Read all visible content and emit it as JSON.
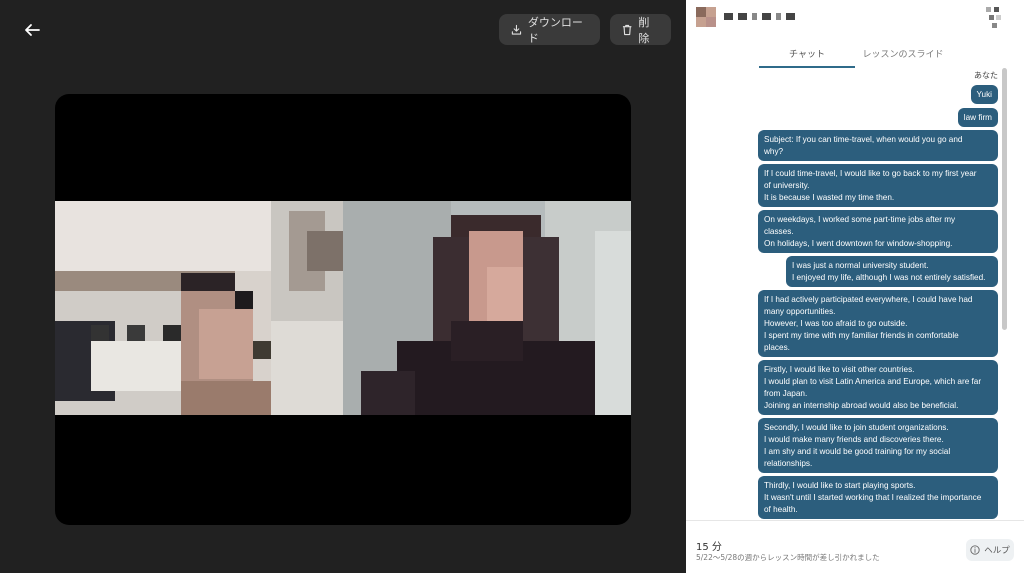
{
  "toolbar": {
    "back_icon": "arrow-left-icon",
    "download_label": "ダウンロード",
    "download_icon": "download-icon",
    "delete_label": "削除",
    "delete_icon": "trash-icon"
  },
  "tabs": [
    {
      "label": "チャット",
      "active": true
    },
    {
      "label": "レッスンのスライド",
      "active": false
    }
  ],
  "chat": {
    "sender_label": "あなた",
    "messages": [
      [
        "Yuki"
      ],
      [
        "law firm"
      ],
      [
        "Subject: If you can time-travel, when would you go and",
        "why?"
      ],
      [
        "If I could time-travel, I would like to go back to my first year",
        "of university.",
        "It is because I wasted my time then."
      ],
      [
        "On weekdays, I worked some part-time jobs after my",
        "classes.",
        "On holidays, I went downtown for window-shopping."
      ],
      [
        "I was just a normal university student.",
        "I enjoyed my life, although I was not entirely satisfied."
      ],
      [
        "If I had actively participated everywhere, I could have had",
        "many opportunities.",
        "However, I was too afraid to go outside.",
        "I spent my time with my familiar friends in comfortable",
        "places."
      ],
      [
        "Firstly, I would like to visit other countries.",
        "I would plan to visit Latin America and Europe, which are far",
        "from Japan.",
        "Joining an internship abroad would also be beneficial."
      ],
      [
        "Secondly, I would like to join student organizations.",
        "I would make many friends and discoveries there.",
        "I am shy and it would be good training for my social",
        "relationships."
      ],
      [
        "Thirdly, I would like to start playing sports.",
        "It wasn't until I started working that I realized the importance",
        "of health."
      ]
    ]
  },
  "footer": {
    "duration": "15 分",
    "note": "5/22〜5/28の週からレッスン時間が差し引かれました",
    "help_label": "ヘルプ",
    "help_icon": "info-circle-icon"
  },
  "colors": {
    "bubble": "#2c5e7d",
    "accent": "#2f6b8a",
    "page_bg": "#212121"
  }
}
